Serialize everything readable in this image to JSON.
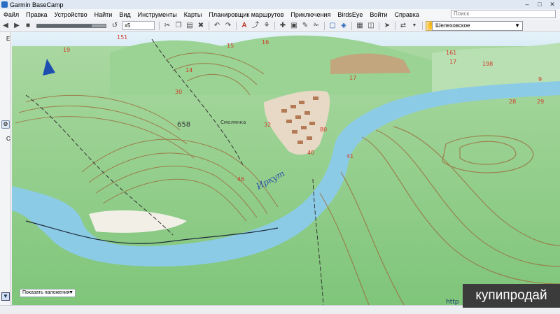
{
  "window": {
    "title": "Garmin BaseCamp"
  },
  "menu": [
    "Файл",
    "Правка",
    "Устройство",
    "Найти",
    "Вид",
    "Инструменты",
    "Карты",
    "Планировщик маршрутов",
    "Приключения",
    "BirdsEye",
    "Войти",
    "Справка"
  ],
  "search": {
    "placeholder": "Поиск"
  },
  "toolbar": {
    "zoom_value": "x5",
    "map_selected": "Шелеховское"
  },
  "left_panel": {
    "tab_e": "E",
    "tab_c": "C"
  },
  "map": {
    "labels": {
      "n19": "19",
      "n151": "151",
      "n15": "15",
      "n16": "16",
      "n14": "14",
      "n30": "30",
      "n17": "17",
      "n161": "161",
      "n17b": "17",
      "n198": "198",
      "n9": "9",
      "n28": "28",
      "n29": "29",
      "n658": "658",
      "n32": "32",
      "n40": "40",
      "n41": "41",
      "n46": "46",
      "n80": "80"
    },
    "river_name": "Иркут",
    "place_name": "Смолянка",
    "corner_text": "http"
  },
  "status": {
    "overlay_label": "Показать наложения"
  },
  "watermark": "купипродай",
  "colors": {
    "terrain": "#8fd08a",
    "water": "#8ccbe6",
    "contour": "#9b6a3a",
    "label": "#d23a2a"
  }
}
